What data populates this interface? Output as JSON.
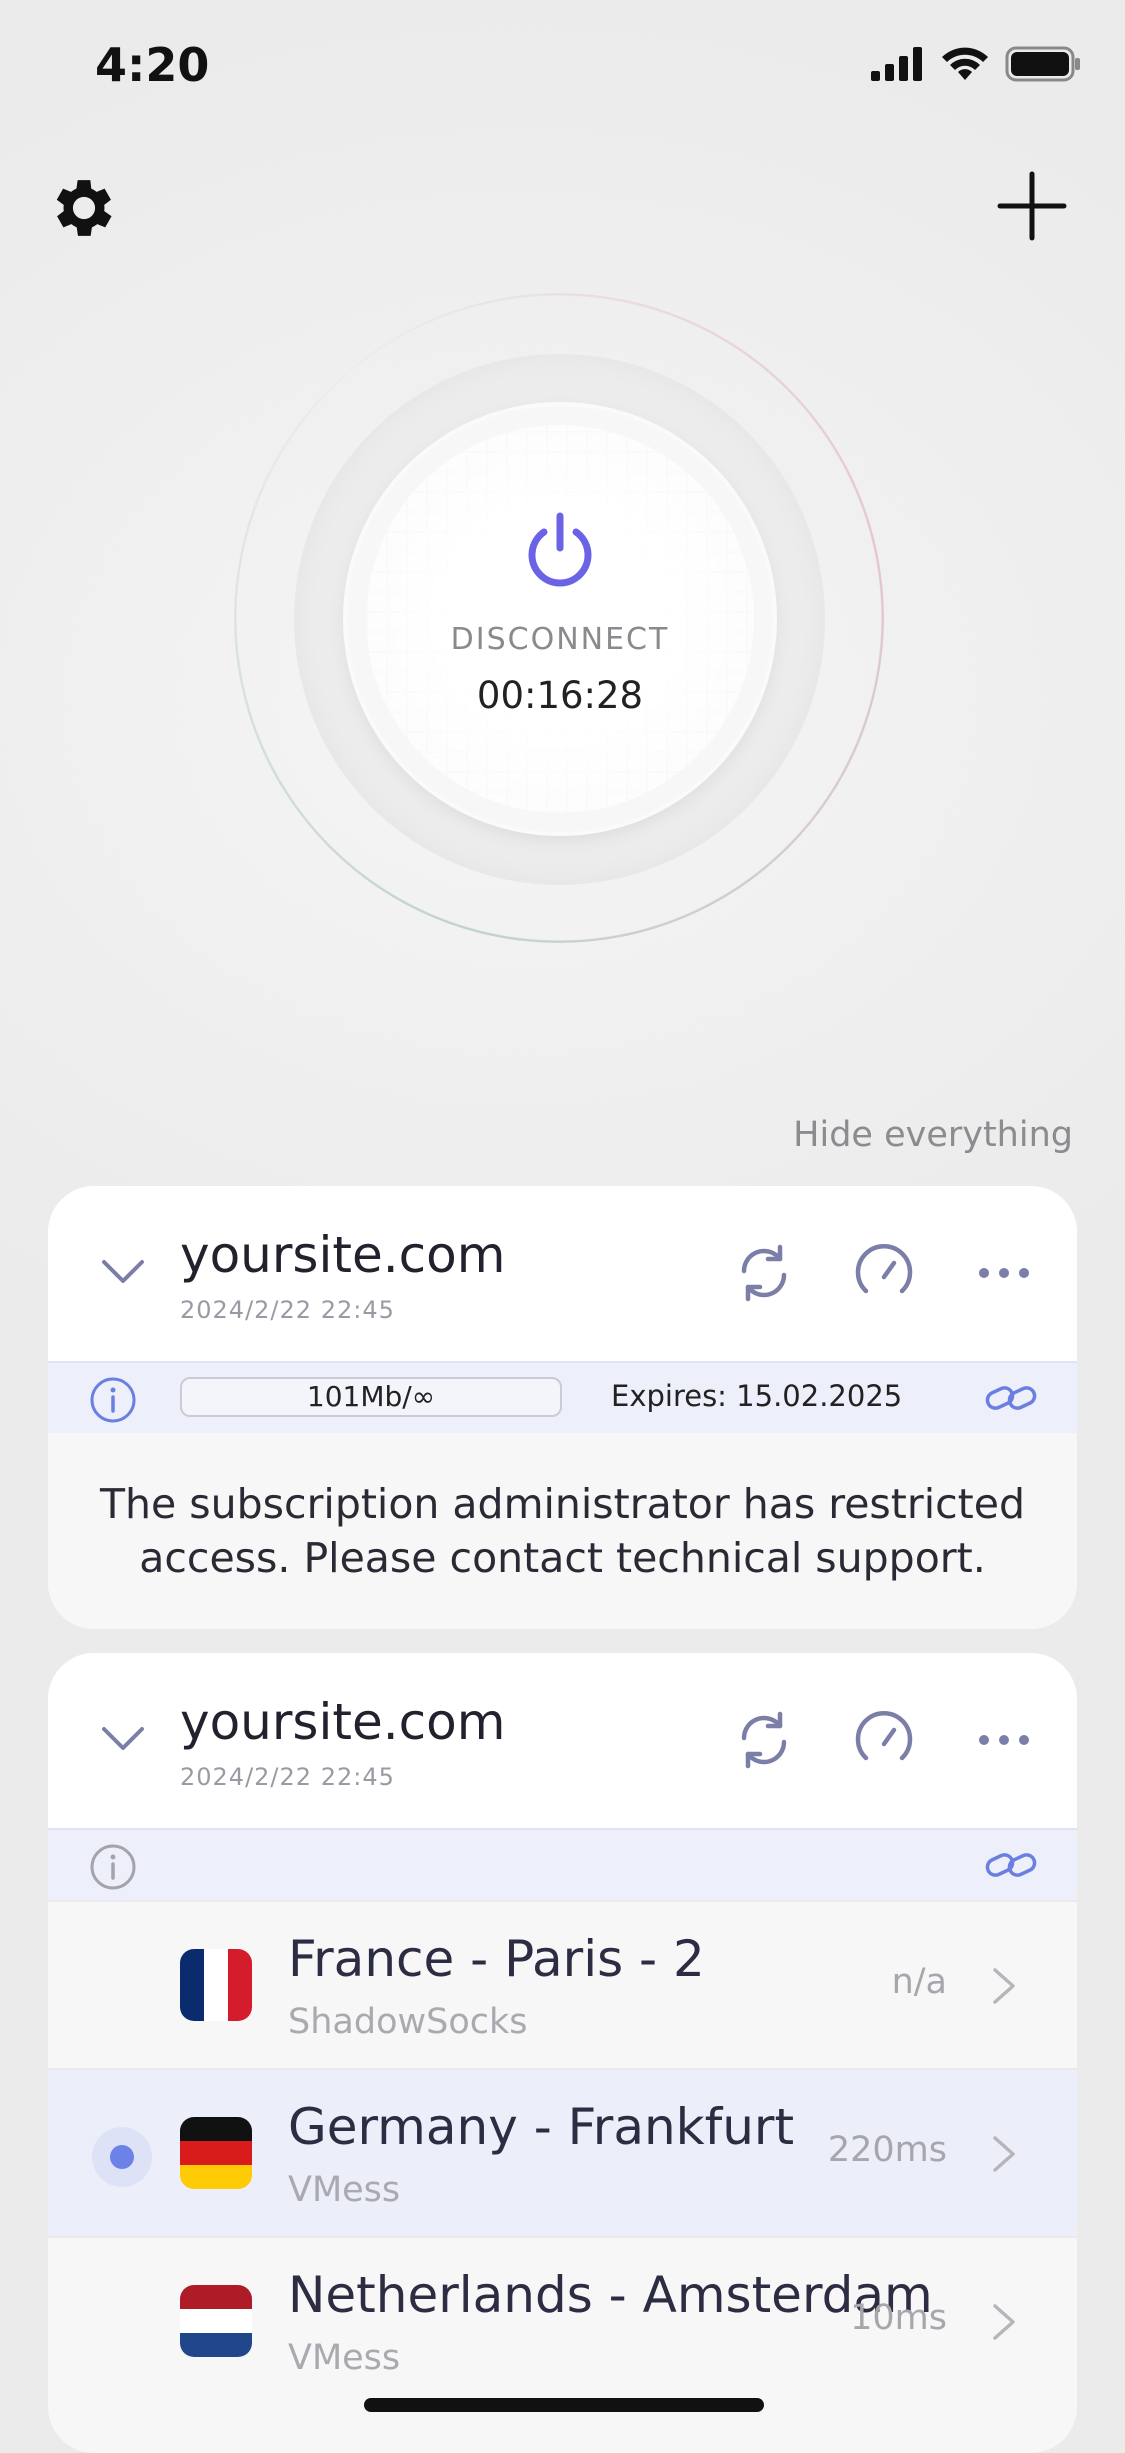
{
  "status_bar": {
    "time": "4:20"
  },
  "connect": {
    "label": "DISCONNECT",
    "timer": "00:16:28",
    "accent": "#6b63e6"
  },
  "hide_everything": "Hide everything",
  "subscriptions": [
    {
      "title": "yoursite.com",
      "date": "2024/2/22 22:45",
      "traffic": "101Mb/∞",
      "expires": "Expires: 15.02.2025",
      "notice": "The subscription administrator has restricted access. Please contact technical support."
    },
    {
      "title": "yoursite.com",
      "date": "2024/2/22 22:45",
      "servers": [
        {
          "name": "France - Paris - 2",
          "protocol": "ShadowSocks",
          "ping": "n/a",
          "flag": "france",
          "selected": false
        },
        {
          "name": "Germany - Frankfurt",
          "protocol": "VMess",
          "ping": "220ms",
          "flag": "germany",
          "selected": true
        },
        {
          "name": "Netherlands - Amsterdam",
          "protocol": "VMess",
          "ping": "10ms",
          "flag": "netherlands",
          "selected": false
        }
      ]
    }
  ],
  "icons": [
    "gear-icon",
    "plus-icon",
    "power-icon",
    "chevron-down-icon",
    "refresh-icon",
    "speedometer-icon",
    "more-icon",
    "info-icon",
    "link-icon",
    "chevron-right-icon"
  ]
}
